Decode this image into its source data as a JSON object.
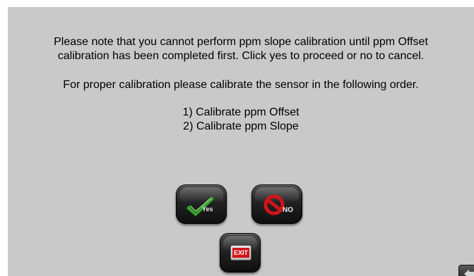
{
  "dialog": {
    "message_line1": "Please note that you cannot perform ppm slope calibration until ppm Offset",
    "message_line2": "calibration has been completed first. Click yes to proceed or no to cancel.",
    "order_note": "For proper calibration please calibrate the sensor in the following order.",
    "steps": [
      "1) Calibrate ppm Offset",
      "2) Calibrate ppm Slope"
    ]
  },
  "buttons": {
    "yes_label": "Yes",
    "no_label": "NO",
    "exit_label": "EXIT"
  },
  "icons": {
    "yes": "checkmark-icon",
    "no": "prohibited-icon",
    "exit": "exit-sign-icon",
    "corner": "back-arrow-icon"
  },
  "colors": {
    "background": "#c9c9c9",
    "check_green": "#3fa335",
    "no_red": "#d0141a",
    "exit_red": "#d0141a"
  }
}
